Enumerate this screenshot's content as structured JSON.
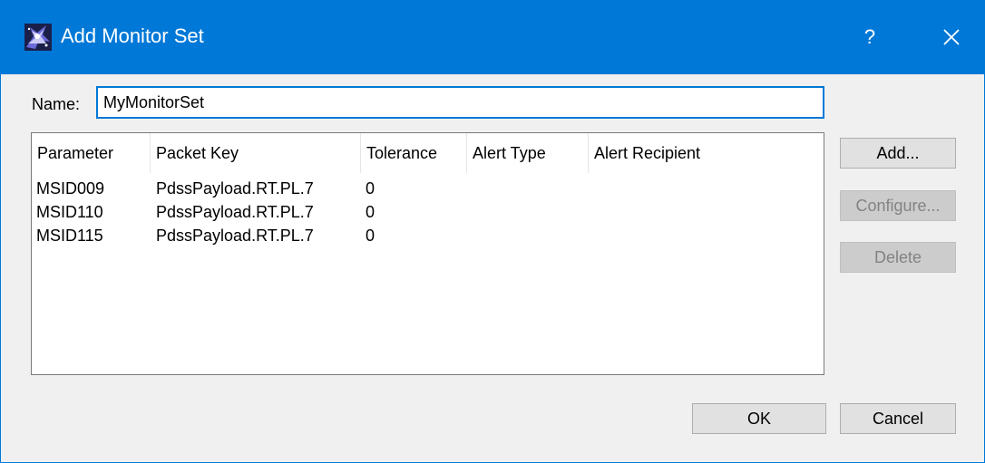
{
  "window": {
    "title": "Add Monitor Set",
    "help_label": "?"
  },
  "form": {
    "name_label": "Name:",
    "name_value": "MyMonitorSet"
  },
  "table": {
    "columns": [
      "Parameter",
      "Packet Key",
      "Tolerance",
      "Alert Type",
      "Alert Recipient"
    ],
    "rows": [
      {
        "parameter": "MSID009",
        "packet_key": "PdssPayload.RT.PL.7",
        "tolerance": "0",
        "alert_type": "",
        "alert_recipient": ""
      },
      {
        "parameter": "MSID110",
        "packet_key": "PdssPayload.RT.PL.7",
        "tolerance": "0",
        "alert_type": "",
        "alert_recipient": ""
      },
      {
        "parameter": "MSID115",
        "packet_key": "PdssPayload.RT.PL.7",
        "tolerance": "0",
        "alert_type": "",
        "alert_recipient": ""
      }
    ]
  },
  "side_buttons": {
    "add_label": "Add...",
    "configure_label": "Configure...",
    "delete_label": "Delete"
  },
  "footer": {
    "ok_label": "OK",
    "cancel_label": "Cancel"
  },
  "colors": {
    "titlebar": "#0078d7",
    "focus_border": "#0078d7",
    "dialog_bg": "#f0f0f0",
    "button_bg": "#e1e1e1",
    "disabled_button_bg": "#cccccc",
    "disabled_text": "#838383"
  },
  "icons": {
    "app": "app-icon",
    "close": "close-icon"
  }
}
